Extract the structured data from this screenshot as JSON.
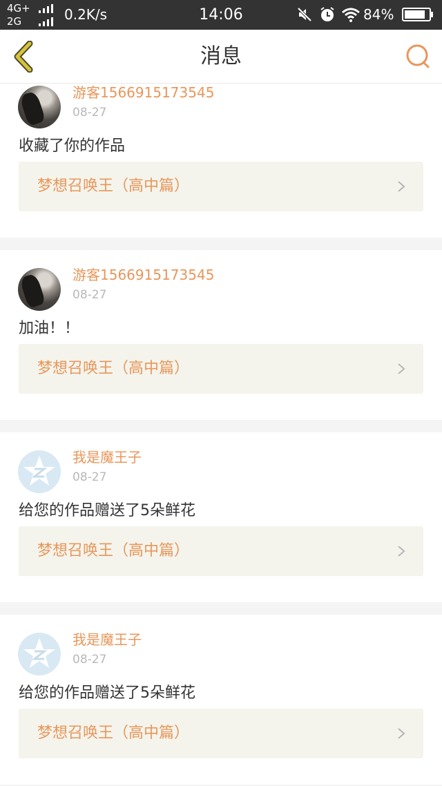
{
  "status_bar": {
    "network_top": "4G+",
    "network_bottom": "2G",
    "speed": "0.2K/s",
    "time": "14:06",
    "battery": "84%"
  },
  "header": {
    "title": "消息"
  },
  "colors": {
    "accent": "#e8965a",
    "back_arrow": "#d7c23a",
    "card_bg": "#ffffff",
    "work_bg": "#f4f4ec",
    "page_bg": "#f4f4f4"
  },
  "messages": [
    {
      "user": "游客1566915173545",
      "date": "08-27",
      "text": "收藏了你的作品",
      "work": "梦想召唤王（高中篇）",
      "avatar": "photo-avatar"
    },
    {
      "user": "游客1566915173545",
      "date": "08-27",
      "text": "加油！！",
      "work": "梦想召唤王（高中篇）",
      "avatar": "photo-avatar"
    },
    {
      "user": "我是魔王子",
      "date": "08-27",
      "text": "给您的作品赠送了5朵鲜花",
      "work": "梦想召唤王（高中篇）",
      "avatar": "qq-default-avatar"
    },
    {
      "user": "我是魔王子",
      "date": "08-27",
      "text": "给您的作品赠送了5朵鲜花",
      "work": "梦想召唤王（高中篇）",
      "avatar": "qq-default-avatar"
    }
  ]
}
